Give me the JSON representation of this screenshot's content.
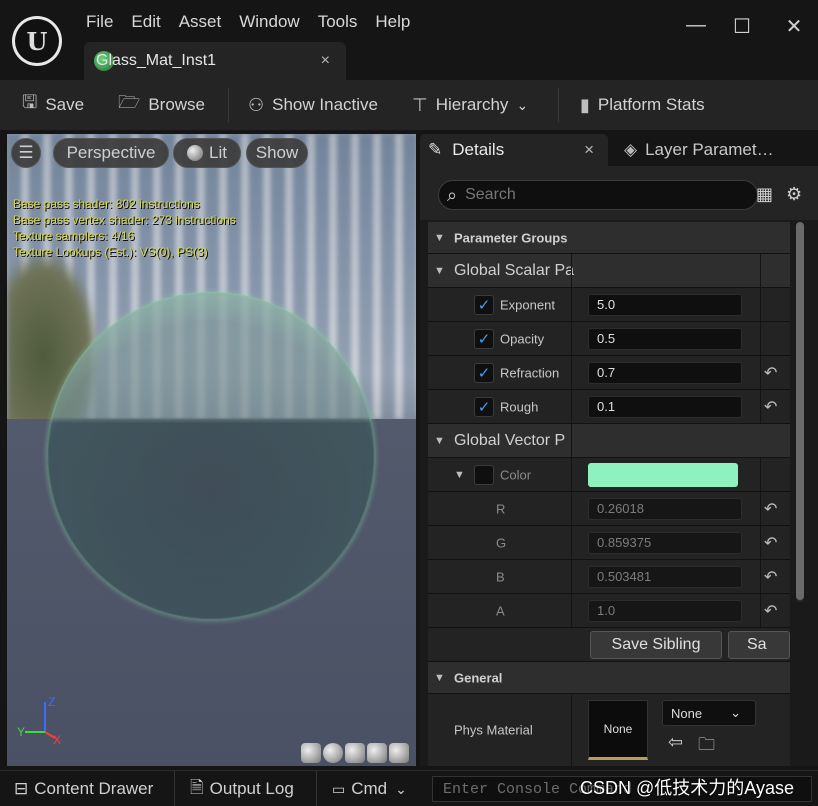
{
  "menu": [
    "File",
    "Edit",
    "Asset",
    "Window",
    "Tools",
    "Help"
  ],
  "window_controls": {
    "minimize": "—",
    "maximize": "☐",
    "close": "✕"
  },
  "document_tab": {
    "title": "Glass_Mat_Inst1",
    "close": "×"
  },
  "toolbar": {
    "save": "Save",
    "browse": "Browse",
    "show_inactive": "Show Inactive",
    "hierarchy": "Hierarchy",
    "platform_stats": "Platform Stats"
  },
  "viewport": {
    "perspective": "Perspective",
    "lit": "Lit",
    "show": "Show",
    "stats": [
      "Base pass shader: 802 instructions",
      "Base pass vertex shader: 273 instructions",
      "Texture samplers: 4/16",
      "Texture Lookups (Est.): VS(0), PS(3)"
    ],
    "axis": {
      "z": "Z",
      "y": "Y",
      "x": "X"
    }
  },
  "panel_tabs": {
    "details": "Details",
    "details_close": "×",
    "layer": "Layer Paramet…"
  },
  "search": {
    "placeholder": "Search"
  },
  "groups": {
    "parameter_groups": "Parameter Groups",
    "global_scalar": "Global Scalar Pa",
    "global_vector": "Global Vector P",
    "general": "General"
  },
  "scalar_params": [
    {
      "name": "Exponent",
      "value": "5.0",
      "checked": true
    },
    {
      "name": "Opacity",
      "value": "0.5",
      "checked": true
    },
    {
      "name": "Refraction",
      "value": "0.7",
      "checked": true
    },
    {
      "name": "Rough",
      "value": "0.1",
      "checked": true
    }
  ],
  "vector_param": {
    "name": "Color",
    "swatch": "#8df2bf",
    "channels": [
      {
        "name": "R",
        "value": "0.26018"
      },
      {
        "name": "G",
        "value": "0.859375"
      },
      {
        "name": "B",
        "value": "0.503481"
      },
      {
        "name": "A",
        "value": "1.0"
      }
    ]
  },
  "buttons": {
    "save_sibling": "Save Sibling",
    "save_child": "Sa"
  },
  "general": {
    "phys_material_label": "Phys Material",
    "thumb": "None",
    "dropdown": "None"
  },
  "bottom": {
    "content_drawer": "Content Drawer",
    "output_log": "Output Log",
    "cmd": "Cmd",
    "console_placeholder": "Enter Console Command"
  },
  "watermark": "CSDN @低技术力的Ayase"
}
